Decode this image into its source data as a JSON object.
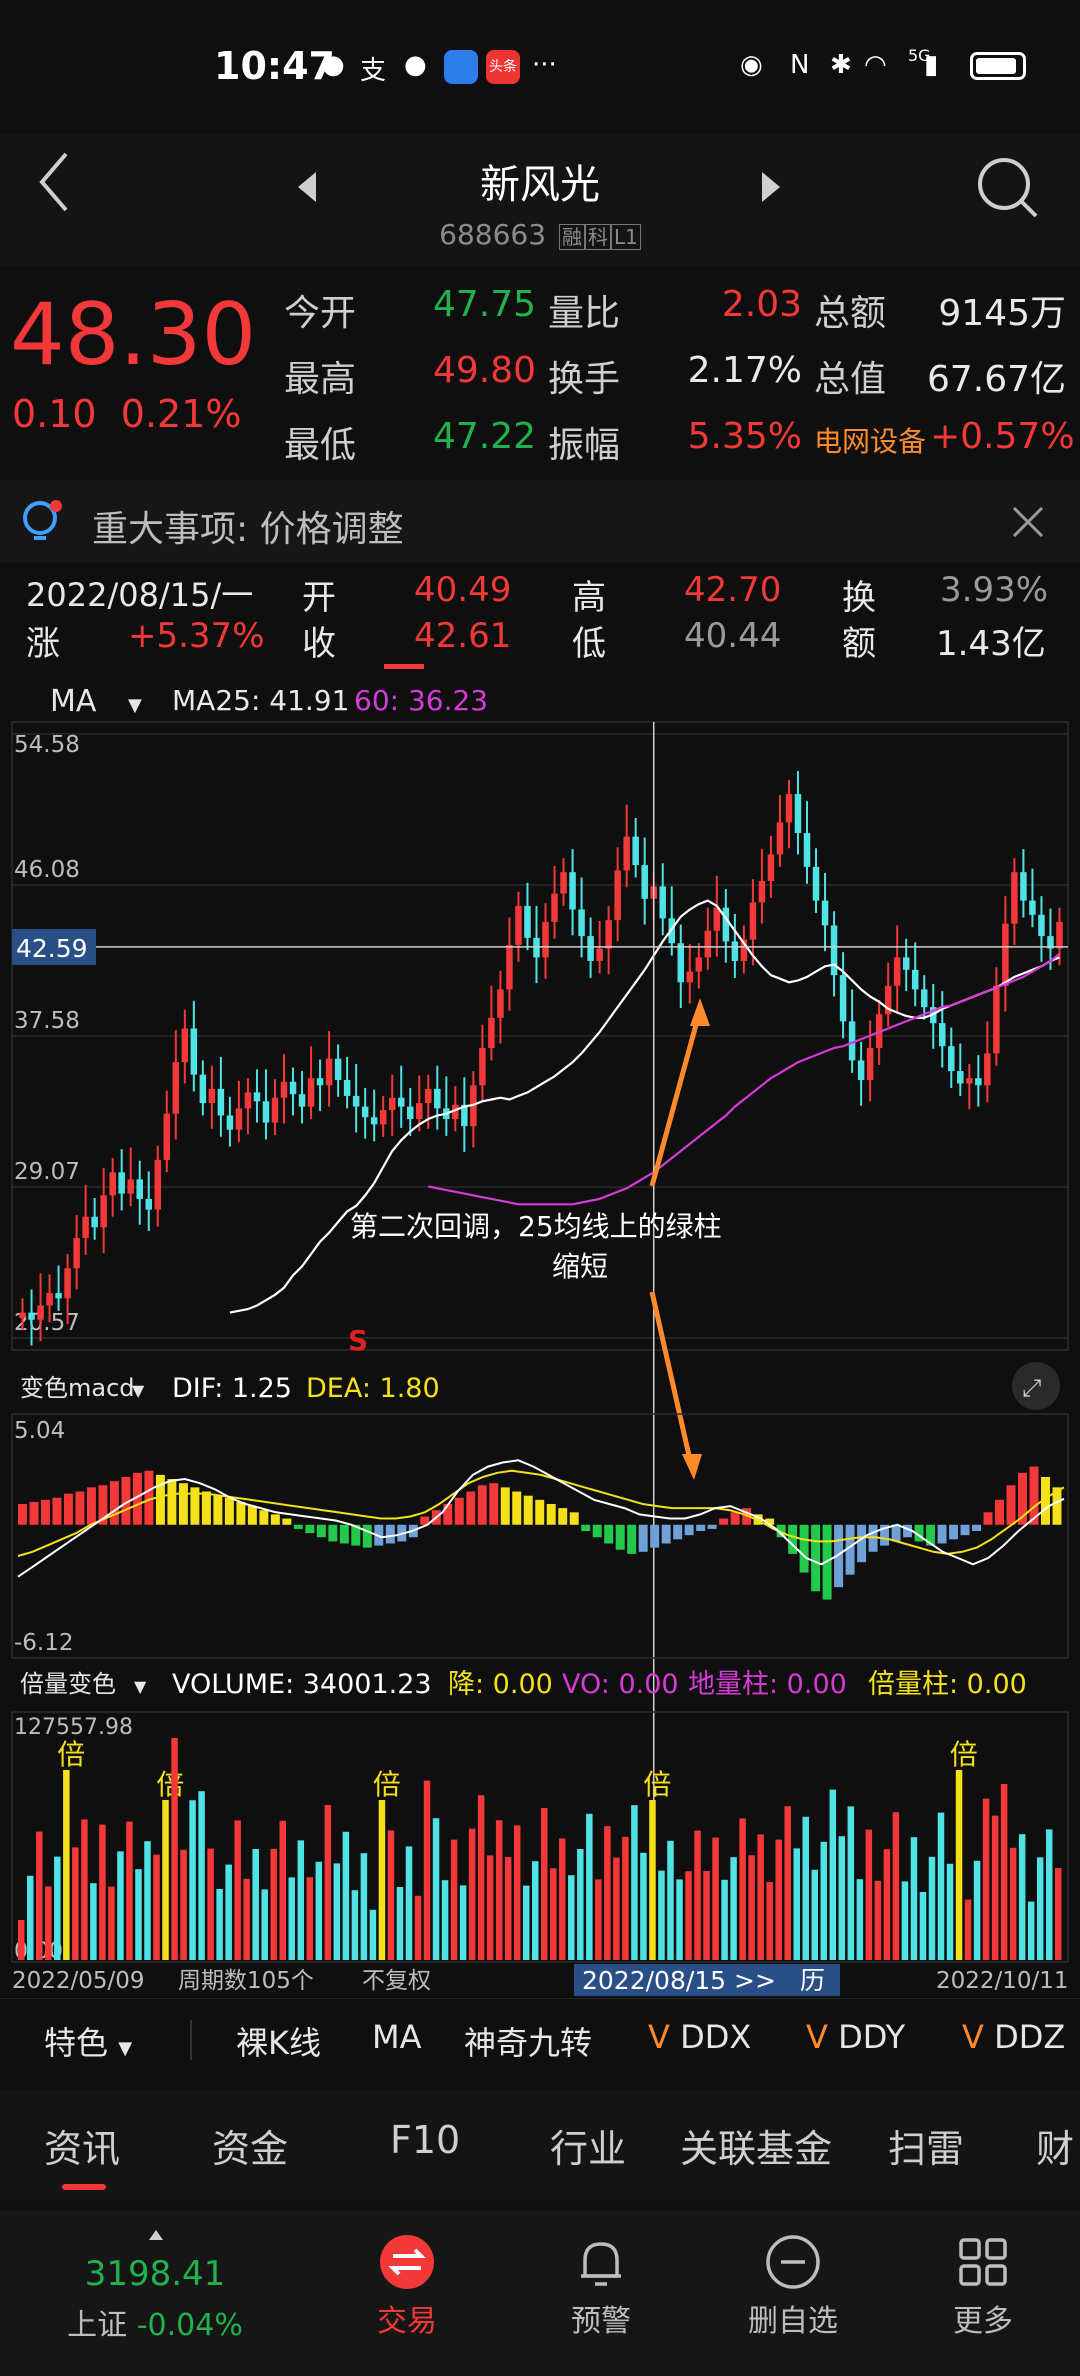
{
  "status": {
    "time": "10:47",
    "network": "5G",
    "left_icons": [
      "wechat-icon",
      "alipay-icon",
      "message-icon",
      "browser-icon",
      "toutiao-icon",
      "more-icon"
    ],
    "right_icons": [
      "eye-icon",
      "nfc-icon",
      "bluetooth-icon",
      "wifi-icon",
      "signal-icon",
      "battery-icon"
    ]
  },
  "header": {
    "name": "新风光",
    "code": "688663",
    "tag1": "融",
    "tag2": "科",
    "tag3": "L1"
  },
  "quote": {
    "price": "48.30",
    "change": "0.10",
    "change_pct": "0.21%",
    "open_label": "今开",
    "open": "47.75",
    "high_label": "最高",
    "high": "49.80",
    "low_label": "最低",
    "low": "47.22",
    "vol_ratio_label": "量比",
    "vol_ratio": "2.03",
    "turnover_label": "换手",
    "turnover": "2.17%",
    "amplitude_label": "振幅",
    "amplitude": "5.35%",
    "amount_label": "总额",
    "amount": "9145万",
    "mktcap_label": "总值",
    "mktcap": "67.67亿",
    "sector": "电网设备",
    "sector_pct": "+0.57%"
  },
  "alert": {
    "text": "重大事项:  价格调整"
  },
  "day_info": {
    "date": "2022/08/15/一",
    "rise_label": "涨",
    "rise": "+5.37%",
    "open_label": "开",
    "open": "40.49",
    "close_label": "收",
    "close": "42.61",
    "high_label": "高",
    "high": "42.70",
    "low_label": "低",
    "low": "40.44",
    "turn_label": "换",
    "turn": "3.93%",
    "amount_label": "额",
    "amount": "1.43亿"
  },
  "ma_bar": {
    "type": "MA",
    "ma25": "MA25: 41.91",
    "ma60": "60: 36.23"
  },
  "chart_data": [
    {
      "type": "candlestick",
      "y_ticks": [
        "54.58",
        "46.08",
        "37.58",
        "29.07",
        "20.57"
      ],
      "crosshair_price": "42.59",
      "ylim": [
        20.57,
        54.58
      ],
      "annotation": "第二次回调，25均线上的绿柱缩短",
      "signal": "S",
      "closes": [
        22.0,
        21.6,
        22.4,
        23.1,
        22.8,
        24.5,
        26.2,
        27.4,
        26.8,
        28.6,
        29.9,
        28.7,
        29.5,
        28.4,
        27.8,
        30.6,
        33.2,
        36.1,
        38.0,
        35.4,
        33.8,
        34.6,
        33.1,
        32.3,
        33.5,
        34.4,
        33.9,
        32.7,
        34.1,
        35.0,
        34.3,
        33.6,
        35.2,
        34.8,
        36.3,
        35.1,
        34.2,
        33.6,
        33.0,
        32.6,
        33.4,
        34.1,
        33.6,
        32.9,
        33.8,
        34.6,
        33.5,
        32.9,
        33.7,
        32.5,
        34.8,
        36.9,
        38.6,
        40.2,
        42.7,
        44.9,
        43.1,
        42.0,
        44.0,
        45.6,
        46.8,
        44.7,
        43.2,
        41.8,
        42.5,
        44.1,
        46.9,
        48.8,
        47.2,
        45.3,
        46.0,
        44.2,
        42.8,
        40.6,
        41.2,
        42.0,
        43.5,
        44.8,
        42.9,
        41.8,
        43.0,
        45.1,
        46.3,
        47.8,
        49.6,
        51.2,
        49.0,
        47.1,
        45.2,
        43.8,
        41.0,
        38.4,
        36.2,
        35.1,
        36.9,
        38.8,
        40.4,
        42.0,
        41.3,
        40.2,
        39.2,
        38.3,
        37.0,
        35.6,
        34.9,
        35.2,
        34.8,
        36.6,
        40.4,
        43.9,
        46.8,
        45.2,
        44.4,
        43.2,
        42.5,
        44.0
      ],
      "ma25": [
        22.0,
        22.1,
        22.2,
        22.4,
        22.7,
        23.0,
        23.4,
        24.1,
        24.6,
        25.3,
        26.0,
        26.5,
        27.1,
        27.7,
        28.0,
        28.6,
        29.3,
        30.2,
        31.1,
        31.7,
        32.2,
        32.6,
        32.9,
        33.1,
        33.2,
        33.4,
        33.6,
        33.7,
        33.9,
        34.0,
        34.1,
        34.0,
        34.2,
        34.4,
        34.7,
        35.0,
        35.3,
        35.7,
        36.1,
        36.6,
        37.2,
        37.8,
        38.5,
        39.2,
        39.9,
        40.6,
        41.3,
        42.1,
        42.9,
        43.6,
        44.3,
        44.7,
        45.0,
        45.2,
        44.9,
        44.2,
        43.5,
        42.8,
        42.1,
        41.5,
        41.0,
        40.8,
        40.6,
        40.7,
        40.9,
        41.2,
        41.5,
        41.6,
        41.2,
        40.7,
        40.2,
        39.8,
        39.5,
        39.1,
        38.9,
        38.7,
        38.6,
        38.6,
        38.8,
        39.1,
        39.3,
        39.5,
        39.7,
        39.9,
        40.1,
        40.3,
        40.6,
        40.9,
        41.1,
        41.3,
        41.5,
        41.8,
        42.0
      ],
      "ma60": [
        29.1,
        29.0,
        28.9,
        28.8,
        28.7,
        28.6,
        28.5,
        28.4,
        28.3,
        28.2,
        28.1,
        28.1,
        28.1,
        28.1,
        28.1,
        28.1,
        28.1,
        28.2,
        28.3,
        28.4,
        28.6,
        28.8,
        29.0,
        29.3,
        29.6,
        29.9,
        30.3,
        30.7,
        31.1,
        31.5,
        31.9,
        32.3,
        32.7,
        33.1,
        33.6,
        34.0,
        34.4,
        34.8,
        35.2,
        35.5,
        35.8,
        36.1,
        36.3,
        36.5,
        36.7,
        36.9,
        37.0,
        37.2,
        37.4,
        37.6,
        37.8,
        38.0,
        38.2,
        38.4,
        38.6,
        38.8,
        39.0,
        39.2,
        39.3,
        39.5,
        39.7,
        39.9,
        40.1,
        40.3,
        40.5,
        40.7,
        40.9,
        41.2,
        41.5,
        41.8,
        42.2
      ]
    },
    {
      "type": "macd",
      "label": "变色macd",
      "dif": "DIF: 1.25",
      "dea": "DEA: 1.80",
      "y_ticks": [
        "5.04",
        "-6.12"
      ],
      "ylim": [
        -6.12,
        5.04
      ],
      "hist": [
        1.0,
        1.1,
        1.2,
        1.3,
        1.5,
        1.6,
        1.8,
        1.9,
        2.1,
        2.3,
        2.5,
        2.6,
        2.4,
        2.2,
        2.0,
        1.8,
        1.6,
        1.4,
        1.3,
        1.1,
        0.9,
        0.7,
        0.5,
        0.3,
        -0.2,
        -0.4,
        -0.6,
        -0.8,
        -0.9,
        -1.0,
        -1.1,
        -1.0,
        -0.9,
        -0.8,
        -0.6,
        0.4,
        0.7,
        1.0,
        1.3,
        1.6,
        1.9,
        2.0,
        1.8,
        1.6,
        1.4,
        1.2,
        1.0,
        0.8,
        0.6,
        -0.3,
        -0.6,
        -0.9,
        -1.2,
        -1.4,
        -1.3,
        -1.1,
        -0.9,
        -0.7,
        -0.5,
        -0.3,
        -0.2,
        0.3,
        0.6,
        0.8,
        0.5,
        0.3,
        -0.6,
        -1.4,
        -2.3,
        -3.2,
        -3.6,
        -3.0,
        -2.4,
        -1.8,
        -1.3,
        -1.0,
        -0.8,
        -0.6,
        -0.8,
        -1.0,
        -0.9,
        -0.7,
        -0.5,
        -0.3,
        0.6,
        1.2,
        1.9,
        2.5,
        2.8,
        2.3,
        1.8
      ],
      "dif_line": [
        -2.5,
        -2.0,
        -1.5,
        -1.0,
        -0.5,
        0.0,
        0.5,
        1.0,
        1.4,
        1.8,
        2.1,
        2.2,
        2.0,
        1.7,
        1.3,
        1.0,
        0.8,
        0.6,
        0.5,
        0.4,
        0.3,
        0.2,
        0.0,
        -0.3,
        -0.6,
        -0.5,
        -0.3,
        0.0,
        0.6,
        1.6,
        2.4,
        2.8,
        3.0,
        3.1,
        2.8,
        2.4,
        2.0,
        1.6,
        1.2,
        1.0,
        0.8,
        0.5,
        0.4,
        0.3,
        0.3,
        0.5,
        0.8,
        0.9,
        0.6,
        0.3,
        -0.2,
        -0.9,
        -1.6,
        -1.9,
        -1.5,
        -1.0,
        -0.5,
        -0.2,
        0.0,
        -0.3,
        -0.8,
        -1.3,
        -1.6,
        -1.9,
        -1.6,
        -1.0,
        -0.3,
        0.3,
        0.9,
        1.25
      ],
      "dea_line": [
        -1.5,
        -1.3,
        -1.0,
        -0.7,
        -0.4,
        0.0,
        0.3,
        0.6,
        0.9,
        1.2,
        1.4,
        1.5,
        1.5,
        1.5,
        1.4,
        1.3,
        1.2,
        1.1,
        1.0,
        0.9,
        0.8,
        0.7,
        0.6,
        0.5,
        0.4,
        0.3,
        0.3,
        0.4,
        0.6,
        1.0,
        1.5,
        2.0,
        2.3,
        2.5,
        2.6,
        2.5,
        2.4,
        2.2,
        2.0,
        1.8,
        1.6,
        1.4,
        1.2,
        1.0,
        0.9,
        0.8,
        0.8,
        0.8,
        0.8,
        0.7,
        0.5,
        0.2,
        -0.2,
        -0.5,
        -0.7,
        -0.8,
        -0.8,
        -0.7,
        -0.6,
        -0.6,
        -0.7,
        -0.9,
        -1.1,
        -1.3,
        -1.4,
        -1.3,
        -1.1,
        -0.7,
        -0.2,
        0.3,
        0.9,
        1.4,
        1.8
      ]
    },
    {
      "type": "volume",
      "label": "倍量变色",
      "volume": "VOLUME: 34001.23",
      "down": "降: 0.00",
      "vo": "VO: 0.00",
      "ground": "地量柱: 0.00",
      "double": "倍量柱: 0.00",
      "y_max": "127557.98",
      "y_min": "0.00",
      "double_marker": "倍",
      "x_start": "2022/05/09",
      "periods": "周期数105个",
      "adjust": "不复权",
      "x_current": "2022/08/15 >>",
      "history": "历",
      "x_end": "2022/10/11"
    }
  ],
  "indicator_tabs": {
    "feature": "特色",
    "naked": "裸K线",
    "ma": "MA",
    "nine": "神奇九转",
    "ddx": "DDX",
    "ddy": "DDY",
    "ddz": "DDZ"
  },
  "news_tabs": [
    "资讯",
    "资金",
    "F10",
    "行业",
    "关联基金",
    "扫雷",
    "财"
  ],
  "bottom_nav": {
    "index_value": "3198.41",
    "index_name": "上证",
    "index_pct": "-0.04%",
    "trade": "交易",
    "alert": "预警",
    "remove": "删自选",
    "more": "更多"
  },
  "colors": {
    "up": "#f23838",
    "down": "#22b14c",
    "candle_down": "#4fe3e6",
    "ma25": "#ffffff",
    "ma60": "#d63ad9",
    "dea": "#f4e11a",
    "accent": "#f23838"
  }
}
